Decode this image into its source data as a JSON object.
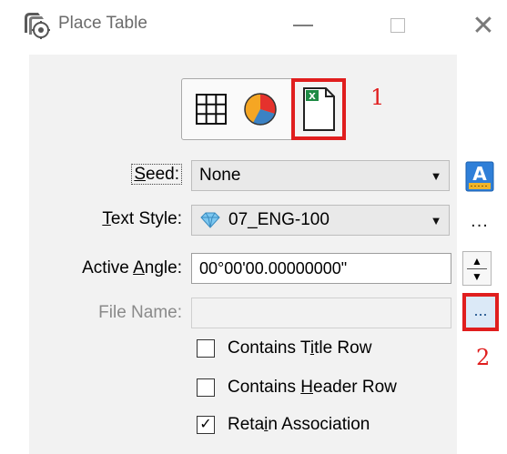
{
  "window": {
    "title": "Place Table"
  },
  "annotations": {
    "callout_1": "1",
    "callout_2": "2",
    "highlight_color": "#e01e1e"
  },
  "modes": [
    {
      "name": "table-grid",
      "icon": "table-grid-icon"
    },
    {
      "name": "chart",
      "icon": "pie-chart-icon"
    },
    {
      "name": "file",
      "icon": "excel-file-icon",
      "selected": true
    }
  ],
  "form": {
    "seed": {
      "label": "Seed:",
      "value": "None"
    },
    "text_style": {
      "label": "Text Style:",
      "value": "07_ENG-100",
      "more": "..."
    },
    "active_angle": {
      "label": "Active Angle:",
      "value": "00°00'00.00000000\""
    },
    "file_name": {
      "label": "File Name:",
      "value": "",
      "browse": "..."
    }
  },
  "options": [
    {
      "label": "Contains Title Row",
      "checked": false
    },
    {
      "label": "Contains Header Row",
      "checked": false
    },
    {
      "label": "Retain Association",
      "checked": true
    }
  ]
}
